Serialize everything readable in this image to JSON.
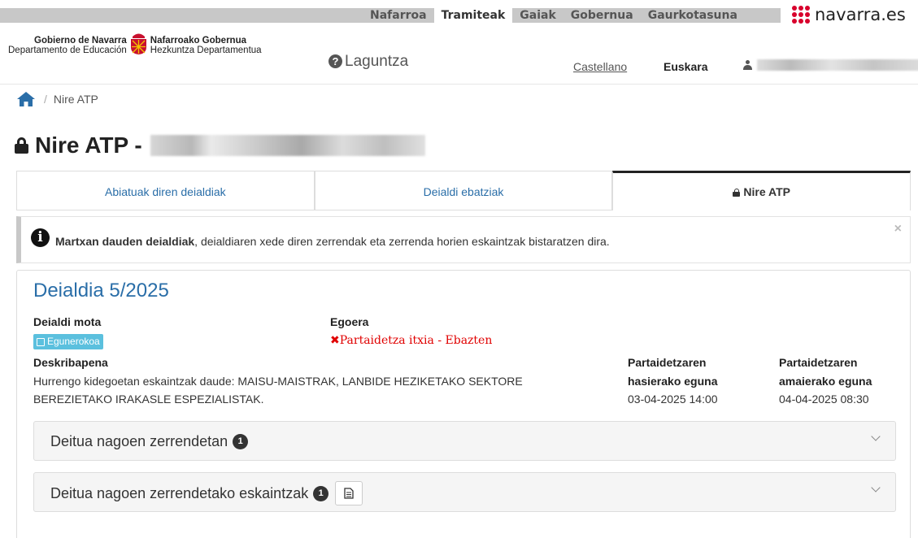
{
  "topnav": {
    "items": [
      "Nafarroa",
      "Tramiteak",
      "Gaiak",
      "Gobernua",
      "Gaurkotasuna"
    ],
    "active_index": 1,
    "brand": "navarra.es",
    "brand_color": "#d8002c"
  },
  "header": {
    "org_left_1": "Gobierno de Navarra",
    "org_left_2": "Departamento de Educación",
    "org_right_1": "Nafarroako Gobernua",
    "org_right_2": "Hezkuntza Departamentua",
    "help": "Laguntza",
    "help_icon": "question-circle-icon",
    "lang_es": "Castellano",
    "lang_eu": "Euskara",
    "user_icon": "user-icon"
  },
  "breadcrumb": {
    "home_icon": "home-icon",
    "current": "Nire ATP"
  },
  "page": {
    "title_prefix": "Nire ATP -"
  },
  "tabs": [
    {
      "label": "Abiatuak diren deialdiak"
    },
    {
      "label": "Deialdi ebatziak"
    },
    {
      "label": "Nire ATP",
      "active": true
    }
  ],
  "alert": {
    "bold": "Martxan dauden deialdiak",
    "text": ", deialdiaren xede diren zerrendak eta zerrenda horien eskaintzak bistaratzen dira.",
    "close": "×"
  },
  "call": {
    "title": "Deialdia 5/2025",
    "type_label": "Deialdi mota",
    "type_value": "Egunerokoa",
    "status_label": "Egoera",
    "status_value": "Partaidetza itxia - Ebazten",
    "status_color": "#e00000",
    "desc_label": "Deskribapena",
    "desc_line1": "Hurrengo kidegoetan eskaintzak daude: MAISU-MAISTRAK, LANBIDE HEZIKETAKO SEKTORE",
    "desc_line2": "BEREZIETAKO IRAKASLE ESPEZIALISTAK.",
    "start_label_1": "Partaidetzaren",
    "start_label_2": "hasierako eguna",
    "start_value": "03-04-2025 14:00",
    "end_label_1": "Partaidetzaren",
    "end_label_2": "amaierako eguna",
    "end_value": "04-04-2025 08:30"
  },
  "panels": [
    {
      "title": "Deitua nagoen zerrendetan",
      "count": "1"
    },
    {
      "title": "Deitua nagoen zerrendetako eskaintzak",
      "count": "1"
    }
  ],
  "colors": {
    "link": "#2a6ea8",
    "info_badge": "#5bc0de"
  }
}
